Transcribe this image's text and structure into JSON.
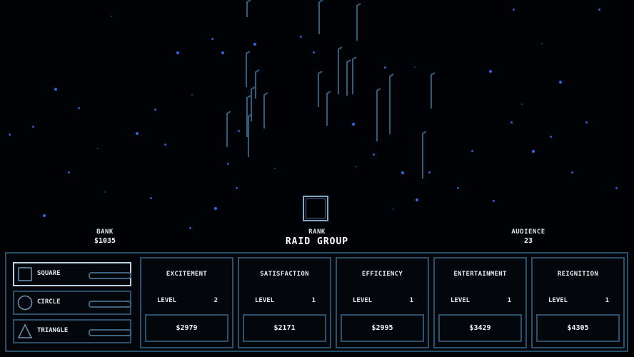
{
  "stats": {
    "bank_label": "BANK",
    "bank_value": "$1035",
    "rank_label": "RANK",
    "rank_value": "RAID GROUP",
    "audience_label": "AUDIENCE",
    "audience_value": "23"
  },
  "shapes": [
    {
      "label": "SQUARE",
      "icon": "square-icon",
      "selected": true
    },
    {
      "label": "CIRCLE",
      "icon": "circle-icon",
      "selected": false
    },
    {
      "label": "TRIANGLE",
      "icon": "triangle-icon",
      "selected": false
    }
  ],
  "upgrades": [
    {
      "name": "EXCITEMENT",
      "level_label": "LEVEL",
      "level": "2",
      "cost": "$2979"
    },
    {
      "name": "SATISFACTION",
      "level_label": "LEVEL",
      "level": "1",
      "cost": "$2171"
    },
    {
      "name": "EFFICIENCY",
      "level_label": "LEVEL",
      "level": "1",
      "cost": "$2995"
    },
    {
      "name": "ENTERTAINMENT",
      "level_label": "LEVEL",
      "level": "1",
      "cost": "$3429"
    },
    {
      "name": "REIGNITION",
      "level_label": "LEVEL",
      "level": "1",
      "cost": "$4305"
    }
  ],
  "colors": {
    "background": "#010206",
    "star": "#2a5cd8",
    "panel_border": "#2a516c",
    "selected_border": "#bcd2e2",
    "text": "#e6ecf2"
  }
}
